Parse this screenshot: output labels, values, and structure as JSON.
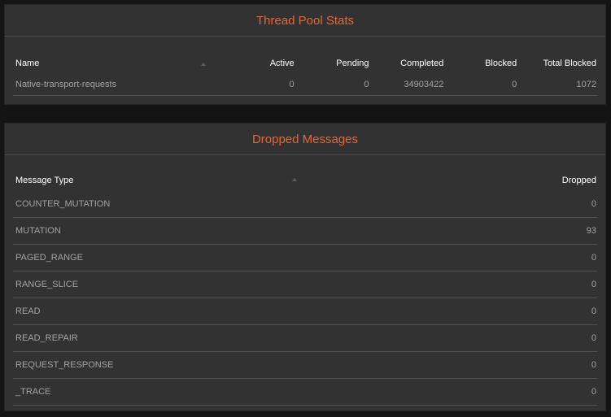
{
  "thread_pool": {
    "title": "Thread Pool Stats",
    "columns": {
      "name": "Name",
      "active": "Active",
      "pending": "Pending",
      "completed": "Completed",
      "blocked": "Blocked",
      "total_blocked": "Total Blocked"
    },
    "rows": [
      {
        "name": "Native-transport-requests",
        "active": "0",
        "pending": "0",
        "completed": "34903422",
        "blocked": "0",
        "total_blocked": "1072"
      }
    ]
  },
  "dropped_messages": {
    "title": "Dropped Messages",
    "columns": {
      "message_type": "Message Type",
      "dropped": "Dropped"
    },
    "rows": [
      {
        "type": "COUNTER_MUTATION",
        "dropped": "0"
      },
      {
        "type": "MUTATION",
        "dropped": "93"
      },
      {
        "type": "PAGED_RANGE",
        "dropped": "0"
      },
      {
        "type": "RANGE_SLICE",
        "dropped": "0"
      },
      {
        "type": "READ",
        "dropped": "0"
      },
      {
        "type": "READ_REPAIR",
        "dropped": "0"
      },
      {
        "type": "REQUEST_RESPONSE",
        "dropped": "0"
      },
      {
        "type": "_TRACE",
        "dropped": "0"
      }
    ]
  },
  "colors": {
    "title_accent": "#e2673a",
    "panel_bg": "#323232",
    "page_bg": "#141414"
  },
  "icons": {
    "sort": "sort-ascending-icon"
  }
}
